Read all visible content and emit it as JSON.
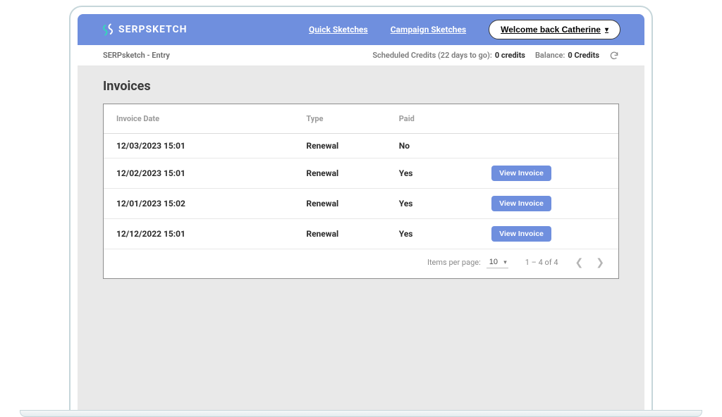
{
  "brand": {
    "name": "SERPSKETCH"
  },
  "nav": {
    "quick_sketches": "Quick Sketches",
    "campaign_sketches": "Campaign Sketches",
    "welcome_label": "Welcome back Catherine"
  },
  "subnav": {
    "breadcrumb": "SERPsketch - Entry",
    "scheduled_label": "Scheduled Credits (22 days to go):",
    "scheduled_value": "0 credits",
    "balance_label": "Balance:",
    "balance_value": "0 Credits"
  },
  "page": {
    "title": "Invoices"
  },
  "table": {
    "headers": {
      "date": "Invoice Date",
      "type": "Type",
      "paid": "Paid"
    },
    "rows": [
      {
        "date": "12/03/2023 15:01",
        "type": "Renewal",
        "paid": "No",
        "has_button": false
      },
      {
        "date": "12/02/2023 15:01",
        "type": "Renewal",
        "paid": "Yes",
        "has_button": true
      },
      {
        "date": "12/01/2023 15:02",
        "type": "Renewal",
        "paid": "Yes",
        "has_button": true
      },
      {
        "date": "12/12/2022 15:01",
        "type": "Renewal",
        "paid": "Yes",
        "has_button": true
      }
    ],
    "view_button_label": "View Invoice"
  },
  "paginator": {
    "items_per_page_label": "Items per page:",
    "page_size": "10",
    "range_label": "1 – 4 of 4"
  }
}
